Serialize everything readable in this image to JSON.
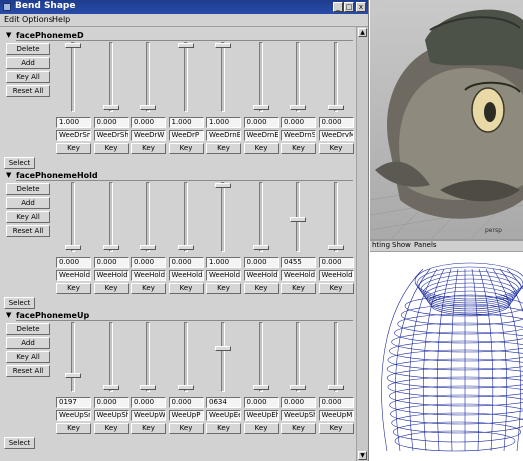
{
  "window": {
    "title": "Bend Shape",
    "close_glyph": "x",
    "max_glyph": "□",
    "min_glyph": "_"
  },
  "menu": {
    "items": [
      "Edit",
      "Options",
      "Help"
    ]
  },
  "sections": [
    {
      "name": "facePhonemeD",
      "buttons": [
        "Delete",
        "Add",
        "Key All",
        "Reset All"
      ],
      "values": [
        "1.000",
        "0.000",
        "0.000",
        "1.000",
        "1.000",
        "0.000",
        "0.000",
        "0.000"
      ],
      "slider_levels": [
        1.0,
        0.0,
        0.0,
        1.0,
        1.0,
        0.0,
        0.0,
        0.0
      ],
      "targets": [
        "WeeDrSm",
        "WeeDrSh",
        "WeeDrW",
        "WeeDrP",
        "WeeDrnEe",
        "WeeDrnEh",
        "WeeDrnSh",
        "WeeDrvM"
      ],
      "key_label": "Key",
      "select_label": "Select"
    },
    {
      "name": "facePhonemeHold",
      "buttons": [
        "Delete",
        "Add",
        "Key All",
        "Reset All"
      ],
      "values": [
        "0.000",
        "0.000",
        "0.000",
        "0.000",
        "1.000",
        "0.000",
        "0455",
        "0.000"
      ],
      "slider_levels": [
        0.0,
        0.0,
        0.0,
        0.0,
        1.0,
        0.0,
        0.455,
        0.0
      ],
      "targets": [
        "WeeHoldSm",
        "WeeHoldSI",
        "WeeHoldW",
        "WeeHoldP",
        "WeeHoldEe",
        "WeeHoldE",
        "WeeHoldC",
        "WeeHoldM"
      ],
      "key_label": "Key",
      "select_label": "Select"
    },
    {
      "name": "facePhonemeUp",
      "buttons": [
        "Delete",
        "Add",
        "Key All",
        "Reset All"
      ],
      "values": [
        "0197",
        "0.000",
        "0.000",
        "0.000",
        "0634",
        "0.000",
        "0.000",
        "0.000"
      ],
      "slider_levels": [
        0.197,
        0.0,
        0.0,
        0.0,
        0.634,
        0.0,
        0.0,
        0.0
      ],
      "targets": [
        "WeeUpSm",
        "WeeUpSh",
        "WeeUpW",
        "WeeUpP",
        "WeeUpEe",
        "WeeUpEh",
        "WeeUpSh",
        "WeeUpM"
      ],
      "key_label": "Key",
      "select_label": "Select"
    }
  ],
  "viewport_top": {
    "menu": [
      "hting",
      "Show",
      "Panels"
    ],
    "caption": "persp"
  },
  "viewport_bottom": {
    "menu": [
      "hting",
      "Show",
      "Panels"
    ]
  },
  "colors": {
    "titlebar": "#1e3c8e",
    "wireframe": "#1a2a9e",
    "panel": "#d2d2d2"
  }
}
